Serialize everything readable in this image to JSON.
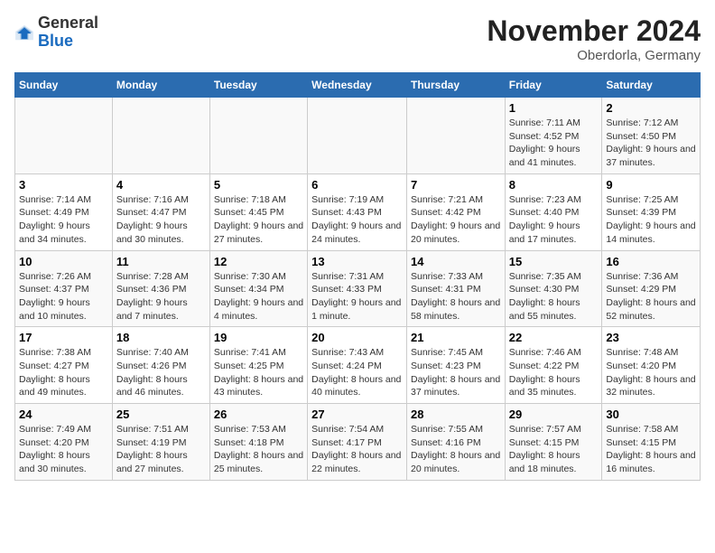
{
  "logo": {
    "general": "General",
    "blue": "Blue"
  },
  "title": "November 2024",
  "subtitle": "Oberdorla, Germany",
  "weekdays": [
    "Sunday",
    "Monday",
    "Tuesday",
    "Wednesday",
    "Thursday",
    "Friday",
    "Saturday"
  ],
  "weeks": [
    [
      {
        "day": "",
        "info": ""
      },
      {
        "day": "",
        "info": ""
      },
      {
        "day": "",
        "info": ""
      },
      {
        "day": "",
        "info": ""
      },
      {
        "day": "",
        "info": ""
      },
      {
        "day": "1",
        "info": "Sunrise: 7:11 AM\nSunset: 4:52 PM\nDaylight: 9 hours and 41 minutes."
      },
      {
        "day": "2",
        "info": "Sunrise: 7:12 AM\nSunset: 4:50 PM\nDaylight: 9 hours and 37 minutes."
      }
    ],
    [
      {
        "day": "3",
        "info": "Sunrise: 7:14 AM\nSunset: 4:49 PM\nDaylight: 9 hours and 34 minutes."
      },
      {
        "day": "4",
        "info": "Sunrise: 7:16 AM\nSunset: 4:47 PM\nDaylight: 9 hours and 30 minutes."
      },
      {
        "day": "5",
        "info": "Sunrise: 7:18 AM\nSunset: 4:45 PM\nDaylight: 9 hours and 27 minutes."
      },
      {
        "day": "6",
        "info": "Sunrise: 7:19 AM\nSunset: 4:43 PM\nDaylight: 9 hours and 24 minutes."
      },
      {
        "day": "7",
        "info": "Sunrise: 7:21 AM\nSunset: 4:42 PM\nDaylight: 9 hours and 20 minutes."
      },
      {
        "day": "8",
        "info": "Sunrise: 7:23 AM\nSunset: 4:40 PM\nDaylight: 9 hours and 17 minutes."
      },
      {
        "day": "9",
        "info": "Sunrise: 7:25 AM\nSunset: 4:39 PM\nDaylight: 9 hours and 14 minutes."
      }
    ],
    [
      {
        "day": "10",
        "info": "Sunrise: 7:26 AM\nSunset: 4:37 PM\nDaylight: 9 hours and 10 minutes."
      },
      {
        "day": "11",
        "info": "Sunrise: 7:28 AM\nSunset: 4:36 PM\nDaylight: 9 hours and 7 minutes."
      },
      {
        "day": "12",
        "info": "Sunrise: 7:30 AM\nSunset: 4:34 PM\nDaylight: 9 hours and 4 minutes."
      },
      {
        "day": "13",
        "info": "Sunrise: 7:31 AM\nSunset: 4:33 PM\nDaylight: 9 hours and 1 minute."
      },
      {
        "day": "14",
        "info": "Sunrise: 7:33 AM\nSunset: 4:31 PM\nDaylight: 8 hours and 58 minutes."
      },
      {
        "day": "15",
        "info": "Sunrise: 7:35 AM\nSunset: 4:30 PM\nDaylight: 8 hours and 55 minutes."
      },
      {
        "day": "16",
        "info": "Sunrise: 7:36 AM\nSunset: 4:29 PM\nDaylight: 8 hours and 52 minutes."
      }
    ],
    [
      {
        "day": "17",
        "info": "Sunrise: 7:38 AM\nSunset: 4:27 PM\nDaylight: 8 hours and 49 minutes."
      },
      {
        "day": "18",
        "info": "Sunrise: 7:40 AM\nSunset: 4:26 PM\nDaylight: 8 hours and 46 minutes."
      },
      {
        "day": "19",
        "info": "Sunrise: 7:41 AM\nSunset: 4:25 PM\nDaylight: 8 hours and 43 minutes."
      },
      {
        "day": "20",
        "info": "Sunrise: 7:43 AM\nSunset: 4:24 PM\nDaylight: 8 hours and 40 minutes."
      },
      {
        "day": "21",
        "info": "Sunrise: 7:45 AM\nSunset: 4:23 PM\nDaylight: 8 hours and 37 minutes."
      },
      {
        "day": "22",
        "info": "Sunrise: 7:46 AM\nSunset: 4:22 PM\nDaylight: 8 hours and 35 minutes."
      },
      {
        "day": "23",
        "info": "Sunrise: 7:48 AM\nSunset: 4:20 PM\nDaylight: 8 hours and 32 minutes."
      }
    ],
    [
      {
        "day": "24",
        "info": "Sunrise: 7:49 AM\nSunset: 4:20 PM\nDaylight: 8 hours and 30 minutes."
      },
      {
        "day": "25",
        "info": "Sunrise: 7:51 AM\nSunset: 4:19 PM\nDaylight: 8 hours and 27 minutes."
      },
      {
        "day": "26",
        "info": "Sunrise: 7:53 AM\nSunset: 4:18 PM\nDaylight: 8 hours and 25 minutes."
      },
      {
        "day": "27",
        "info": "Sunrise: 7:54 AM\nSunset: 4:17 PM\nDaylight: 8 hours and 22 minutes."
      },
      {
        "day": "28",
        "info": "Sunrise: 7:55 AM\nSunset: 4:16 PM\nDaylight: 8 hours and 20 minutes."
      },
      {
        "day": "29",
        "info": "Sunrise: 7:57 AM\nSunset: 4:15 PM\nDaylight: 8 hours and 18 minutes."
      },
      {
        "day": "30",
        "info": "Sunrise: 7:58 AM\nSunset: 4:15 PM\nDaylight: 8 hours and 16 minutes."
      }
    ]
  ]
}
